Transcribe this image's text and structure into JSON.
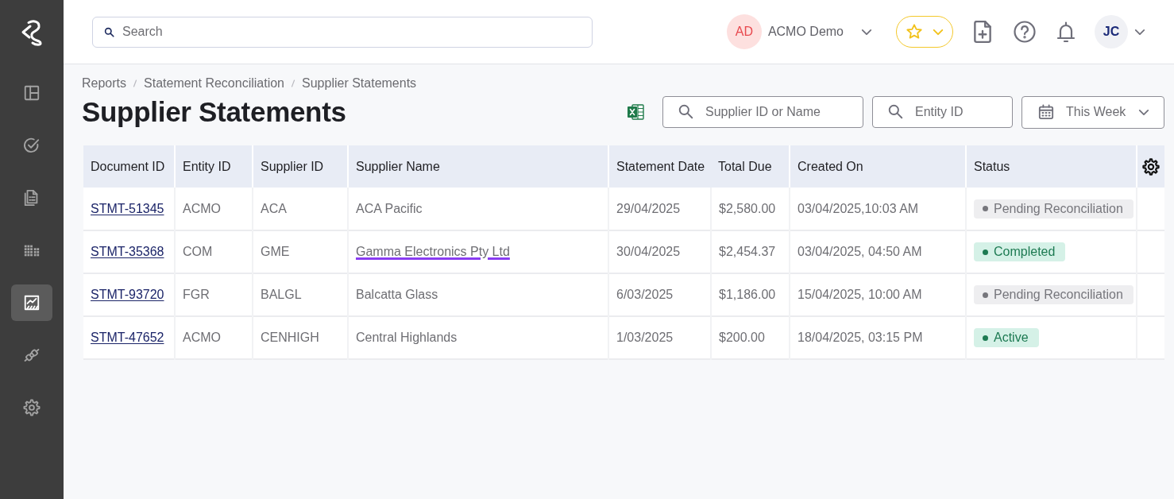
{
  "sidebar": {
    "items": [
      {
        "selected": false
      },
      {
        "selected": false
      },
      {
        "selected": false
      },
      {
        "selected": false
      },
      {
        "selected": true
      },
      {
        "selected": false
      },
      {
        "selected": false
      }
    ]
  },
  "header": {
    "search": {
      "placeholder": "Search"
    },
    "organization": {
      "initials": "AD",
      "name": "ACMO Demo"
    },
    "user": {
      "initials": "JC"
    }
  },
  "breadcrumb": [
    "Reports",
    "Statement Reconciliation",
    "Supplier Statements"
  ],
  "title": "Supplier Statements",
  "filters": {
    "supplier_search": {
      "placeholder": "Supplier ID or Name"
    },
    "entity_search": {
      "placeholder": "Entity ID"
    },
    "date_range": {
      "value": "This Week"
    }
  },
  "table": {
    "columns": [
      "Document ID",
      "Entity ID",
      "Supplier ID",
      "Supplier Name",
      "Statement Date",
      "Total Due",
      "Created On",
      "Status"
    ],
    "rows": [
      {
        "document_id": "STMT-51345",
        "entity_id": "ACMO",
        "supplier_id": "ACA",
        "supplier_name": "ACA Pacific",
        "name_underlined": false,
        "statement_date": "29/04/2025",
        "total_due": "$2,580.00",
        "created_on": "03/04/2025,10:03 AM",
        "status": {
          "label": "Pending Reconciliation",
          "kind": "pending"
        }
      },
      {
        "document_id": "STMT-35368",
        "entity_id": "COM",
        "supplier_id": "GME",
        "supplier_name": "Gamma Electronics Pty Ltd",
        "name_underlined": true,
        "statement_date": "30/04/2025",
        "total_due": "$2,454.37",
        "created_on": "03/04/2025, 04:50 AM",
        "status": {
          "label": "Completed",
          "kind": "completed"
        }
      },
      {
        "document_id": "STMT-93720",
        "entity_id": "FGR",
        "supplier_id": "BALGL",
        "supplier_name": "Balcatta Glass",
        "name_underlined": false,
        "statement_date": "6/03/2025",
        "total_due": "$1,186.00",
        "created_on": "15/04/2025, 10:00 AM",
        "status": {
          "label": "Pending Reconciliation",
          "kind": "pending"
        }
      },
      {
        "document_id": "STMT-47652",
        "entity_id": "ACMO",
        "supplier_id": "CENHIGH",
        "supplier_name": "Central Highlands",
        "name_underlined": false,
        "statement_date": "1/03/2025",
        "total_due": "$200.00",
        "created_on": "18/04/2025, 03:15 PM",
        "status": {
          "label": "Active",
          "kind": "active"
        }
      }
    ]
  }
}
